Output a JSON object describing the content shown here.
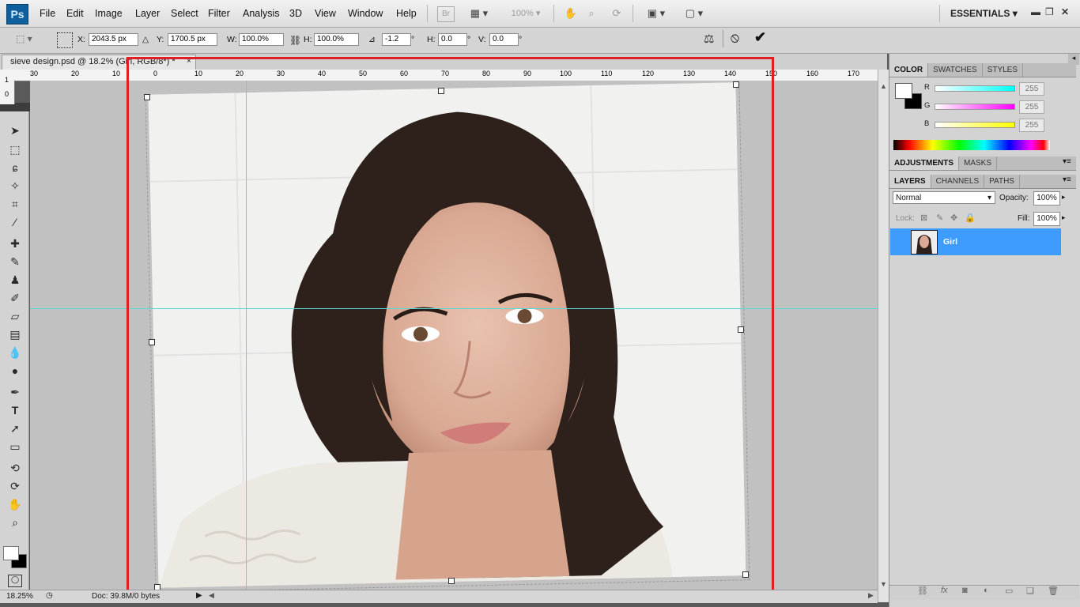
{
  "app": {
    "logo": "Ps"
  },
  "menu": {
    "items": [
      "File",
      "Edit",
      "Image",
      "Layer",
      "Select",
      "Filter",
      "Analysis",
      "3D",
      "View",
      "Window",
      "Help"
    ]
  },
  "menubar_icons": {
    "bridge": "Br",
    "zoom_level": "100%",
    "workspace": "ESSENTIALS"
  },
  "options": {
    "x_label": "X:",
    "x_value": "2043.5 px",
    "y_label": "Y:",
    "y_value": "1700.5 px",
    "w_label": "W:",
    "w_value": "100.0%",
    "h_label": "H:",
    "h_value": "100.0%",
    "angle_value": "-1.2",
    "deg": "°",
    "hskew_label": "H:",
    "hskew_value": "0.0",
    "vskew_label": "V:",
    "vskew_value": "0.0"
  },
  "document": {
    "tab_title": "sieve design.psd @ 18.2% (Girl, RGB/8*) *",
    "close": "×"
  },
  "ruler": {
    "h_ticks": [
      "30",
      "20",
      "10",
      "0",
      "10",
      "20",
      "30",
      "40",
      "50",
      "60",
      "70",
      "80",
      "90",
      "100",
      "110",
      "120",
      "130",
      "140",
      "150",
      "160",
      "170"
    ],
    "v_ticks": [
      "1",
      "0"
    ]
  },
  "status": {
    "zoom": "18.25%",
    "doc": "Doc: 39.8M/0 bytes"
  },
  "panels": {
    "color_tabs": [
      "COLOR",
      "SWATCHES",
      "STYLES"
    ],
    "color_channels": [
      {
        "label": "R",
        "value": "255",
        "color": "#00ffff"
      },
      {
        "label": "G",
        "value": "255",
        "color": "#ff00ff"
      },
      {
        "label": "B",
        "value": "255",
        "color": "#ffff00"
      }
    ],
    "adjust_tabs": [
      "ADJUSTMENTS",
      "MASKS"
    ],
    "layer_tabs": [
      "LAYERS",
      "CHANNELS",
      "PATHS"
    ],
    "blend_mode": "Normal",
    "opacity_label": "Opacity:",
    "opacity_value": "100%",
    "lock_label": "Lock:",
    "fill_label": "Fill:",
    "fill_value": "100%",
    "layer_name": "Girl"
  },
  "colors": {
    "selection_box": "#e01f25",
    "guide": "#56d8d8",
    "layer_selected": "#3f9cff"
  }
}
